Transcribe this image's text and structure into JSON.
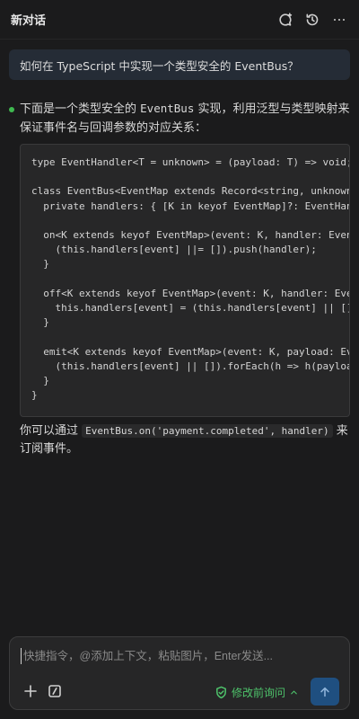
{
  "header": {
    "title": "新对话"
  },
  "messages": {
    "user": "如何在 TypeScript 中实现一个类型安全的 EventBus？",
    "assistant": {
      "intro_part1": "下面是一个类型安全的 ",
      "intro_code": "EventBus",
      "intro_part2": " 实现，利用泛型与类型映射来保证事件名与回调参数的对应关系：",
      "code": "type EventHandler<T = unknown> = (payload: T) => void;\n\nclass EventBus<EventMap extends Record<string, unknown>> {\n  private handlers: { [K in keyof EventMap]?: EventHandler<EventMap[K]>[] } = {};\n\n  on<K extends keyof EventMap>(event: K, handler: EventHandler<EventMap[K]>) {\n    (this.handlers[event] ||= []).push(handler);\n  }\n\n  off<K extends keyof EventMap>(event: K, handler: EventHandler<EventMap[K]>) {\n    this.handlers[event] = (this.handlers[event] || []).filter(h => h !== handler);\n  }\n\n  emit<K extends keyof EventMap>(event: K, payload: EventMap[K]) {\n    (this.handlers[event] || []).forEach(h => h(payload));\n  }\n}",
      "outro_part1": "你可以通过 ",
      "outro_code": "EventBus.on('payment.completed', handler)",
      "outro_part2": " 来订阅事件。"
    }
  },
  "composer": {
    "placeholder": "快捷指令，@添加上下文，粘贴图片，Enter发送...",
    "ask_before_label": "修改前询问"
  },
  "colors": {
    "background": "#1b1b1c",
    "accent_green": "#4ec36b",
    "send_button": "#1f4f80"
  }
}
